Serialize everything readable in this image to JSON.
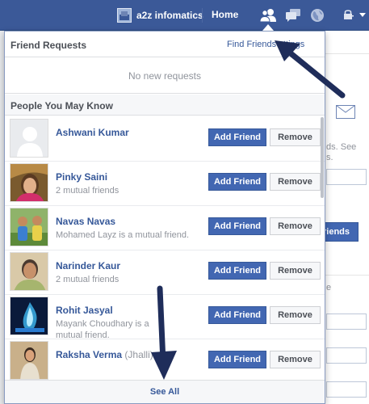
{
  "topbar": {
    "user_name": "a2z infomatics",
    "home_label": "Home",
    "icons": [
      "friend-requests-icon",
      "messages-icon",
      "notifications-globe-icon",
      "privacy-lock-icon",
      "account-caret-icon"
    ],
    "bg_color": "#3b5998"
  },
  "panel": {
    "title": "Friend Requests",
    "find_friends": "Find Friends",
    "settings": "ttings",
    "empty_message": "No new requests",
    "people_heading": "People You May Know",
    "add_label": "Add Friend",
    "remove_label": "Remove",
    "see_all": "See All",
    "people": [
      {
        "name": "Ashwani Kumar",
        "extra": "",
        "mutual": ""
      },
      {
        "name": "Pinky Saini",
        "extra": "",
        "mutual": "2 mutual friends"
      },
      {
        "name": "Navas Navas",
        "extra": "",
        "mutual": "Mohamed Layz is a mutual friend."
      },
      {
        "name": "Narinder Kaur",
        "extra": "",
        "mutual": "2 mutual friends"
      },
      {
        "name": "Rohit Jasyal",
        "extra": "",
        "mutual": "Mayank Choudhary is a mutual friend."
      },
      {
        "name": "Raksha Verma",
        "extra": "(Jhalli)",
        "mutual": ""
      }
    ]
  },
  "background": {
    "partial_text_1": "ds. See",
    "partial_text_2": "s.",
    "partial_button": "riends",
    "partial_text_3": "e"
  },
  "colors": {
    "accent": "#4267b2",
    "link": "#365899",
    "annotation_arrow": "#1f2d5a"
  }
}
